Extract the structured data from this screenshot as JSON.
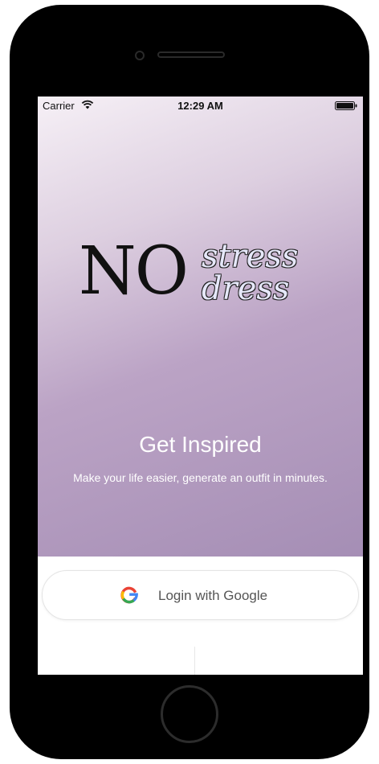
{
  "status_bar": {
    "carrier": "Carrier",
    "time": "12:29 AM"
  },
  "logo": {
    "no": "NO",
    "stress": "stress",
    "dress": "dress"
  },
  "hero": {
    "title": "Get Inspired",
    "subtitle": "Make your life easier, generate an outfit in minutes."
  },
  "login": {
    "label": "Login with Google",
    "icon": "google-icon"
  },
  "colors": {
    "hero_gradient_start": "#f6f0f6",
    "hero_gradient_end": "#a58eb5",
    "text_on_hero": "#ffffff",
    "phone_body": "#000000"
  }
}
